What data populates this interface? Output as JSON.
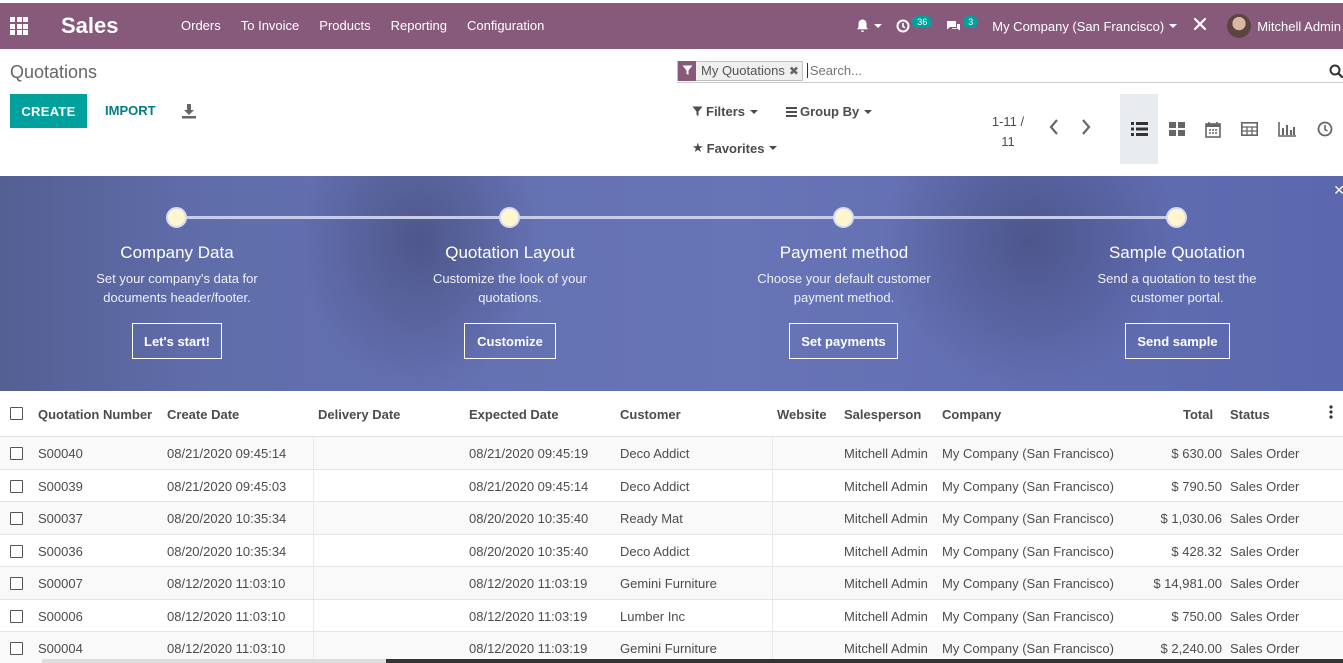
{
  "navbar": {
    "app_name": "Sales",
    "menu": [
      "Orders",
      "To Invoice",
      "Products",
      "Reporting",
      "Configuration"
    ],
    "activity_count": "36",
    "messages_count": "3",
    "company": "My Company (San Francisco)",
    "user": "Mitchell Admin",
    "bg_color": "#875a7b"
  },
  "control_panel": {
    "breadcrumb": "Quotations",
    "create_label": "CREATE",
    "import_label": "IMPORT",
    "facet_label": "My Quotations",
    "search_placeholder": "Search...",
    "filters_label": "Filters",
    "group_by_label": "Group By",
    "favorites_label": "Favorites",
    "pager_line1": "1-11 /",
    "pager_line2": "11"
  },
  "banner": {
    "steps": [
      {
        "title": "Company Data",
        "desc1": "Set your company's data for",
        "desc2": "documents header/footer.",
        "button": "Let's start!"
      },
      {
        "title": "Quotation Layout",
        "desc1": "Customize the look of your",
        "desc2": "quotations.",
        "button": "Customize"
      },
      {
        "title": "Payment method",
        "desc1": "Choose your default customer",
        "desc2": "payment method.",
        "button": "Set payments"
      },
      {
        "title": "Sample Quotation",
        "desc1": "Send a quotation to test the",
        "desc2": "customer portal.",
        "button": "Send sample"
      }
    ]
  },
  "table": {
    "headers": {
      "number": "Quotation Number",
      "create_date": "Create Date",
      "delivery_date": "Delivery Date",
      "expected_date": "Expected Date",
      "customer": "Customer",
      "website": "Website",
      "salesperson": "Salesperson",
      "company": "Company",
      "total": "Total",
      "status": "Status"
    },
    "rows": [
      {
        "number": "S00040",
        "create_date": "08/21/2020 09:45:14",
        "expected_date": "08/21/2020 09:45:19",
        "customer": "Deco Addict",
        "salesperson": "Mitchell Admin",
        "company": "My Company (San Francisco)",
        "total": "$ 630.00",
        "status": "Sales Order"
      },
      {
        "number": "S00039",
        "create_date": "08/21/2020 09:45:03",
        "expected_date": "08/21/2020 09:45:14",
        "customer": "Deco Addict",
        "salesperson": "Mitchell Admin",
        "company": "My Company (San Francisco)",
        "total": "$ 790.50",
        "status": "Sales Order"
      },
      {
        "number": "S00037",
        "create_date": "08/20/2020 10:35:34",
        "expected_date": "08/20/2020 10:35:40",
        "customer": "Ready Mat",
        "salesperson": "Mitchell Admin",
        "company": "My Company (San Francisco)",
        "total": "$ 1,030.06",
        "status": "Sales Order"
      },
      {
        "number": "S00036",
        "create_date": "08/20/2020 10:35:34",
        "expected_date": "08/20/2020 10:35:40",
        "customer": "Deco Addict",
        "salesperson": "Mitchell Admin",
        "company": "My Company (San Francisco)",
        "total": "$ 428.32",
        "status": "Sales Order"
      },
      {
        "number": "S00007",
        "create_date": "08/12/2020 11:03:10",
        "expected_date": "08/12/2020 11:03:19",
        "customer": "Gemini Furniture",
        "salesperson": "Mitchell Admin",
        "company": "My Company (San Francisco)",
        "total": "$ 14,981.00",
        "status": "Sales Order"
      },
      {
        "number": "S00006",
        "create_date": "08/12/2020 11:03:10",
        "expected_date": "08/12/2020 11:03:19",
        "customer": "Lumber Inc",
        "salesperson": "Mitchell Admin",
        "company": "My Company (San Francisco)",
        "total": "$ 750.00",
        "status": "Sales Order"
      },
      {
        "number": "S00004",
        "create_date": "08/12/2020 11:03:10",
        "expected_date": "08/12/2020 11:03:19",
        "customer": "Gemini Furniture",
        "salesperson": "Mitchell Admin",
        "company": "My Company (San Francisco)",
        "total": "$ 2,240.00",
        "status": "Sales Order"
      }
    ]
  },
  "icons": [
    "apps-grid-icon",
    "bell-icon",
    "activity-clock-icon",
    "chat-icon",
    "debug-icon",
    "download-icon",
    "filter-icon",
    "close-icon",
    "search-icon",
    "list-view-icon",
    "kanban-view-icon",
    "calendar-view-icon",
    "pivot-view-icon",
    "graph-view-icon",
    "activity-view-icon",
    "chevron-left-icon",
    "chevron-right-icon",
    "star-icon",
    "bars-icon"
  ],
  "colors": {
    "primary": "#875a7b",
    "accent": "#00a09d",
    "banner": "#6370b0"
  }
}
